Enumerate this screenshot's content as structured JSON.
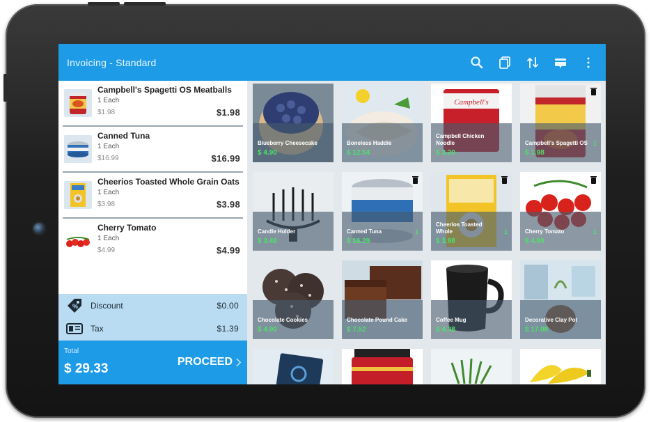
{
  "app": {
    "title": "Invoicing - Standard"
  },
  "toolbar": {
    "icons": [
      "search-icon",
      "copy-icon",
      "sort-icon",
      "card-icon",
      "more-vert-icon"
    ]
  },
  "cart": {
    "items": [
      {
        "name": "Campbell's Spagetti OS Meatballs",
        "qty": "1 Each",
        "unit_price": "$1.98",
        "total": "$1.98"
      },
      {
        "name": "Canned Tuna",
        "qty": "1 Each",
        "unit_price": "$16.99",
        "total": "$16.99"
      },
      {
        "name": "Cheerios Toasted Whole Grain Oats",
        "qty": "1 Each",
        "unit_price": "$3.98",
        "total": "$3.98"
      },
      {
        "name": "Cherry Tomato",
        "qty": "1 Each",
        "unit_price": "$4.99",
        "total": "$4.99"
      }
    ]
  },
  "summary": {
    "discount_label": "Discount",
    "discount_value": "$0.00",
    "tax_label": "Tax",
    "tax_value": "$1.39"
  },
  "totals": {
    "label": "Total",
    "value": "$ 29.33",
    "proceed_label": "PROCEED"
  },
  "products": [
    {
      "name": "Blueberry Cheesecake",
      "price": "$ 4.90",
      "qty": ""
    },
    {
      "name": "Boneless Haddie",
      "price": "$ 12.54",
      "qty": ""
    },
    {
      "name": "Campbell Chicken Noodle",
      "price": "$ 3.20",
      "qty": ""
    },
    {
      "name": "Campbell's Spagetti OS",
      "price": "$ 1.98",
      "qty": "1"
    },
    {
      "name": "Candle Holder",
      "price": "$ 3.48",
      "qty": ""
    },
    {
      "name": "Canned Tuna",
      "price": "$ 16.29",
      "qty": "1"
    },
    {
      "name": "Cheerios Toasted Whole",
      "price": "$ 3.98",
      "qty": "1"
    },
    {
      "name": "Cherry Tomato",
      "price": "$ 4.99",
      "qty": "1"
    },
    {
      "name": "Chocolate Cookies",
      "price": "$ 4.90",
      "qty": ""
    },
    {
      "name": "Chocolate Pound Cake",
      "price": "$ 7.52",
      "qty": ""
    },
    {
      "name": "Coffee Mug",
      "price": "$ 4.38",
      "qty": ""
    },
    {
      "name": "Decorative Clay Pot",
      "price": "$ 17.08",
      "qty": ""
    },
    {
      "name": "",
      "price": "",
      "qty": ""
    },
    {
      "name": "",
      "price": "",
      "qty": ""
    },
    {
      "name": "",
      "price": "",
      "qty": ""
    },
    {
      "name": "",
      "price": "",
      "qty": ""
    }
  ]
}
